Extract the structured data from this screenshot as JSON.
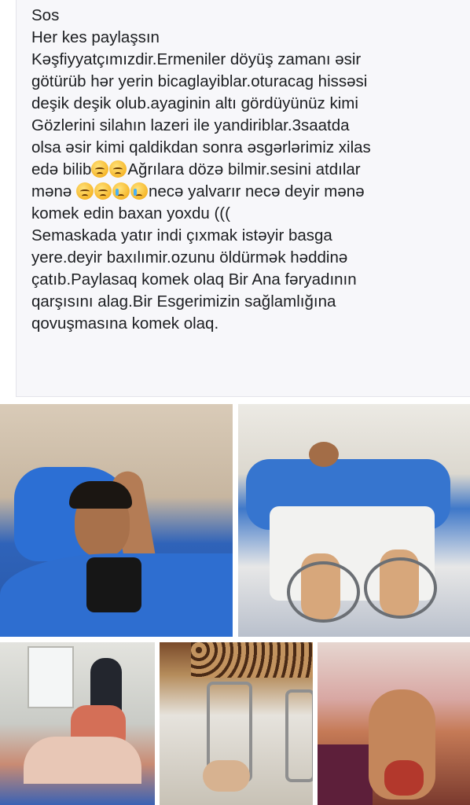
{
  "post": {
    "lines": [
      "Sos",
      "Her kes paylaşsın",
      "Kəşfiyyatçımızdir.Ermeniler döyüş zamanı əsir",
      "götürüb hər yerin bicaglayiblar.oturacag hissəsi",
      "deşik deşik olub.ayaginin altı gördüyünüz kimi",
      "Gözlerini silahın lazeri ile yandiriblar.3saatda",
      "olsa əsir kimi qaldikdan sonra əsgərlərimiz xilas",
      "",
      "",
      "komek edin baxan yoxdu (((",
      "Semaskada yatır indi çıxmak istəyir basga",
      "yere.deyir baxılımir.ozunu öldürmək həddinə",
      "çatıb.Paylasaq komek olaq Bir Ana fəryadının",
      "qarşısını alag.Bir Esgerimizin sağlamlığına",
      "qovuşmasına komek olaq."
    ],
    "line8_a": "edə bilib",
    "line8_b": "Ağrılara dözə bilmir.sesini atdılar",
    "line9_a": "mənə ",
    "line9_b": "necə yalvarır necə deyir mənə"
  },
  "emoji_names": [
    "pensive-face-icon",
    "pensive-face-icon",
    "pensive-face-icon",
    "pensive-face-icon",
    "crying-face-icon",
    "crying-face-icon"
  ],
  "photos": [
    {
      "name": "photo-patient-in-bed"
    },
    {
      "name": "photo-patient-legs-fixators"
    },
    {
      "name": "photo-hospital-room"
    },
    {
      "name": "photo-leg-fixator-closeup"
    },
    {
      "name": "photo-foot-wound-closeup"
    }
  ]
}
